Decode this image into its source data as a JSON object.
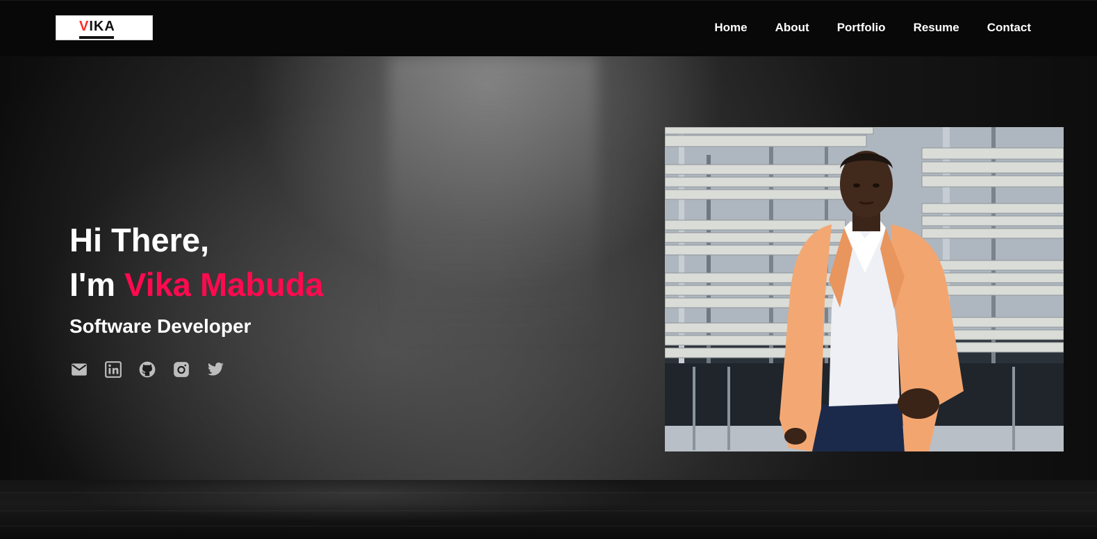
{
  "header": {
    "logo": {
      "first_letter": "V",
      "rest": "IKA"
    },
    "nav": [
      {
        "label": "Home"
      },
      {
        "label": "About"
      },
      {
        "label": "Portfolio"
      },
      {
        "label": "Resume"
      },
      {
        "label": "Contact"
      }
    ]
  },
  "hero": {
    "greeting": "Hi There,",
    "name_prefix": "I'm ",
    "name": "Vika Mabuda",
    "role": "Software Developer",
    "socials": [
      {
        "icon": "email-icon"
      },
      {
        "icon": "linkedin-icon"
      },
      {
        "icon": "github-icon"
      },
      {
        "icon": "instagram-icon"
      },
      {
        "icon": "twitter-icon"
      }
    ]
  },
  "colors": {
    "accent": "#ff0a4f",
    "logo_accent": "#ff2a2a",
    "nav_background": "#080808",
    "icon_color": "#bdbdbd"
  }
}
